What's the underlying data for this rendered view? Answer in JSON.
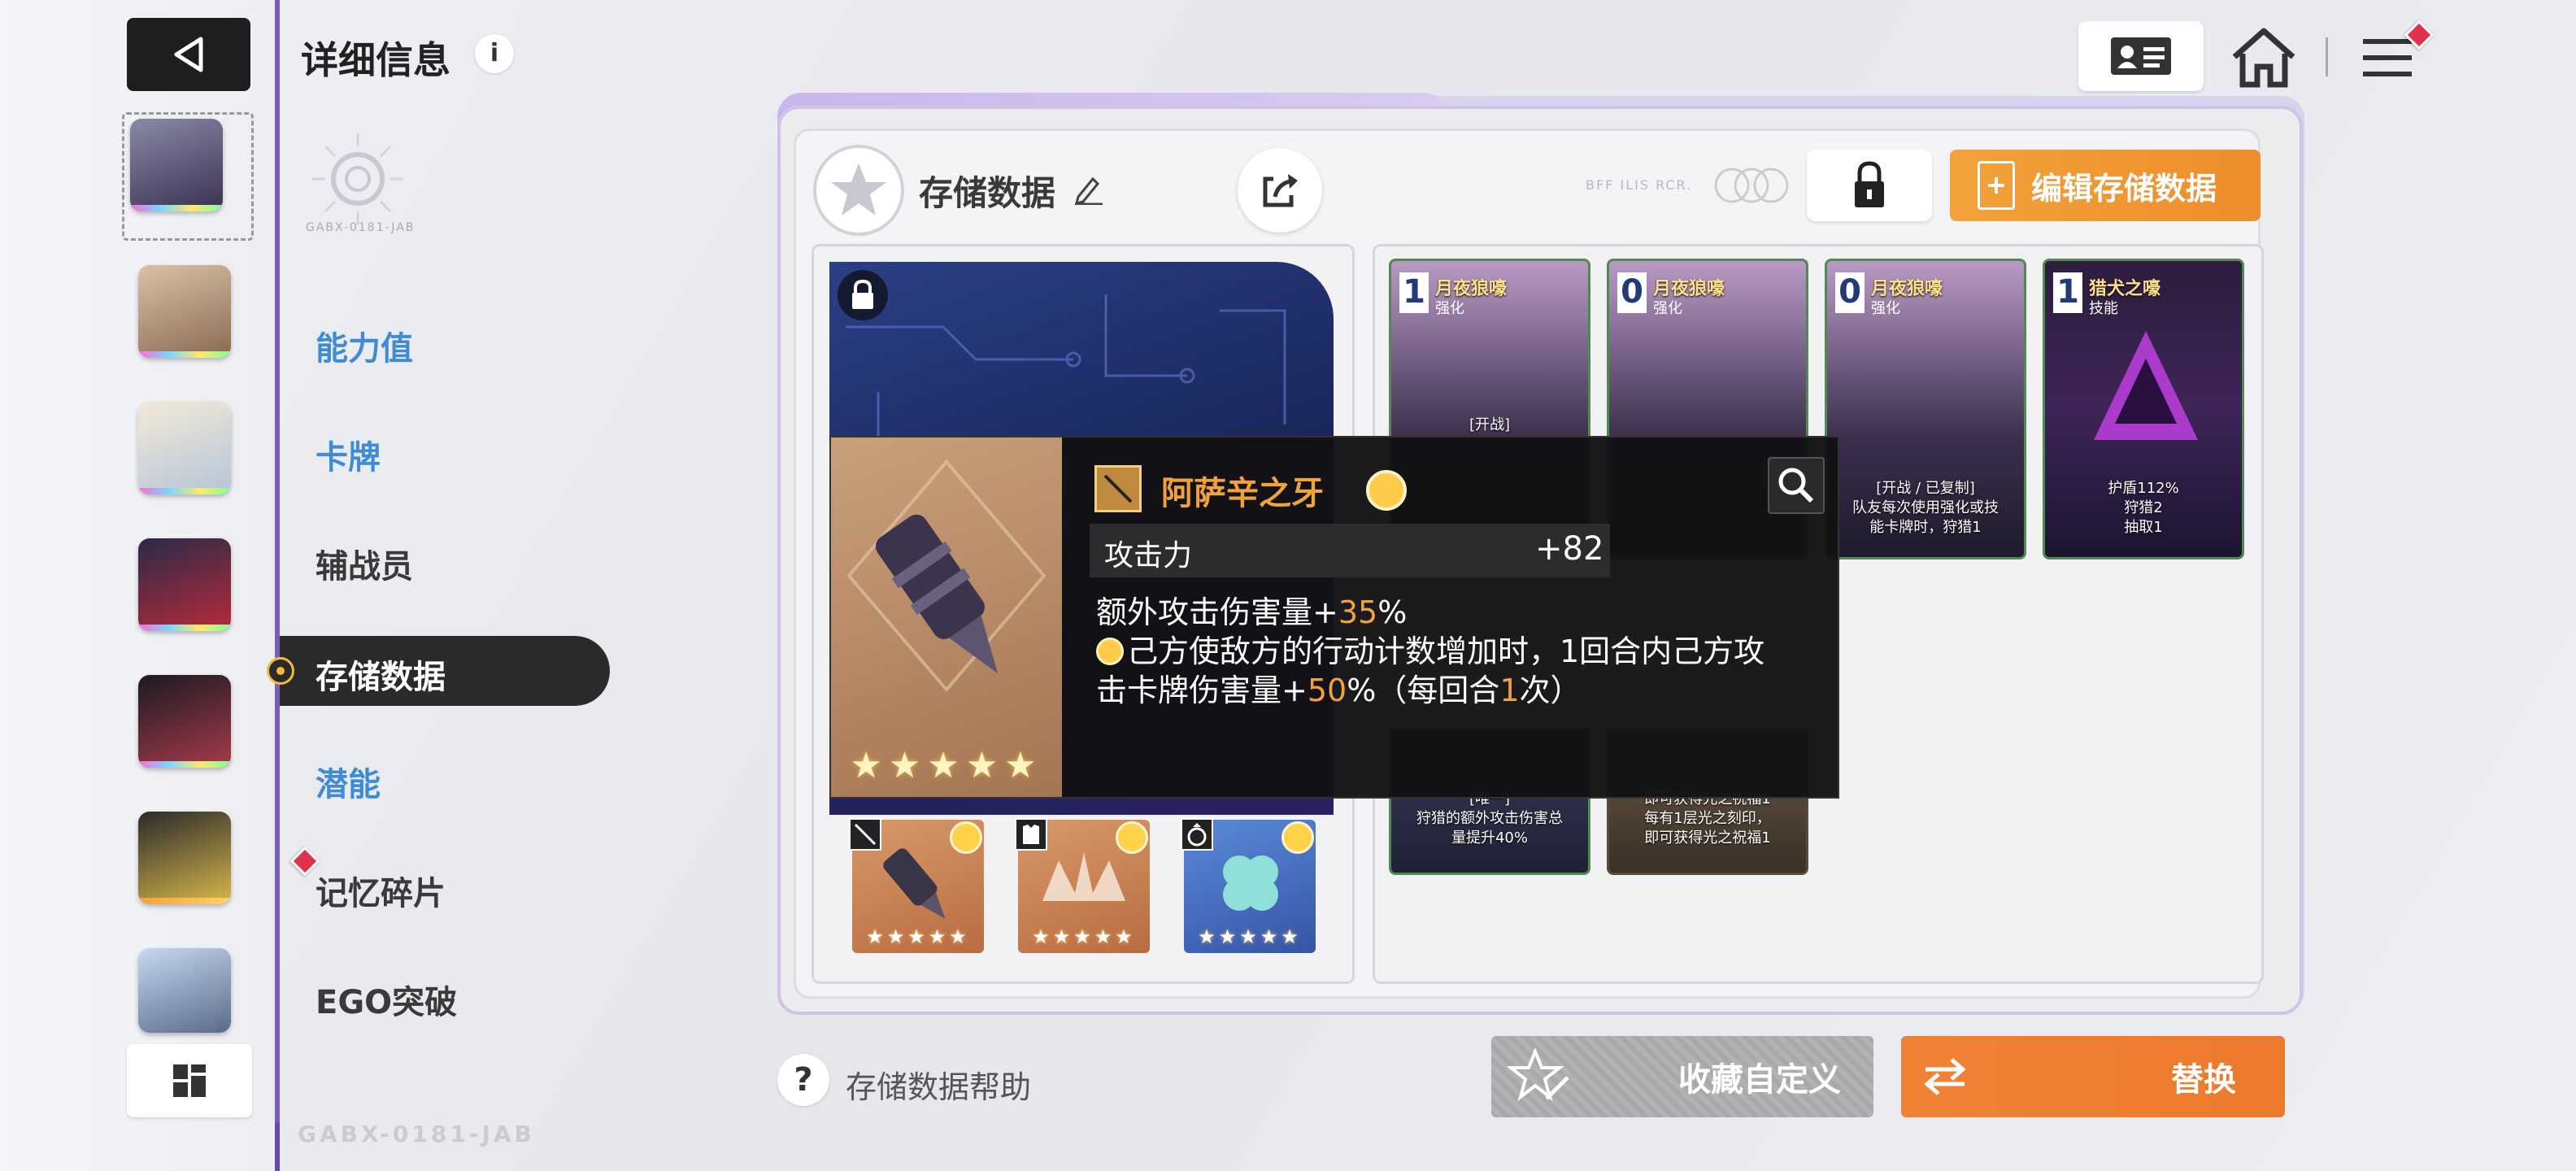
{
  "header": {
    "title": "详细信息",
    "info_label": "i",
    "emblem_text": "GABX-0181-JAB"
  },
  "side_menu": {
    "items": [
      {
        "label": "能力值"
      },
      {
        "label": "卡牌"
      },
      {
        "label": "辅战员"
      },
      {
        "label": "存储数据"
      },
      {
        "label": "潜能"
      },
      {
        "label": "记忆碎片"
      },
      {
        "label": "EGO突破"
      }
    ],
    "active": "存储数据",
    "footer_tag": "GABX-0181-JAB"
  },
  "storage": {
    "title": "存储数据",
    "faint_label": "BFF ILIS RCR.",
    "edit_button": "编辑存储数据"
  },
  "tooltip": {
    "name": "阿萨辛之牙",
    "stat_name": "攻击力",
    "stat_value": "+82",
    "line1_prefix": "额外攻击伤害量+",
    "line1_value": "35",
    "line1_suffix": "%",
    "line2_a": "己方使敌方的行动计数增加时，1回合内己方攻",
    "line3_a": "击卡牌伤害量+",
    "line3_value": "50",
    "line3_b": "%（每回合",
    "line3_count": "1",
    "line3_c": "次）",
    "stars": "★★★★★"
  },
  "equipment": {
    "slots": [
      {
        "stars": "★★★★★"
      },
      {
        "stars": "★★★★★"
      },
      {
        "stars": "★★★★★"
      }
    ]
  },
  "deck": {
    "cards": [
      {
        "cost": "1",
        "name": "月夜狼嚎",
        "type": "强化",
        "desc": "[开战]"
      },
      {
        "cost": "0",
        "name": "月夜狼嚎",
        "type": "强化",
        "desc": ""
      },
      {
        "cost": "0",
        "name": "月夜狼嚎",
        "type": "强化",
        "desc": "[开战 / 已复制]\n队友每次使用强化或技\n能卡牌时，狩猎1"
      },
      {
        "cost": "1",
        "name": "猎犬之嚎",
        "type": "技能",
        "desc": "护盾112%\n狩猎2\n抽取1"
      }
    ],
    "lower_cards": [
      {
        "desc": "[唯一]\n狩猎的额外攻击伤害总\n量提升40%"
      },
      {
        "desc": "即可获得光之祝福1\n每有1层光之刻印，\n即可获得光之祝福1"
      }
    ]
  },
  "bottom": {
    "help_icon": "?",
    "help_label": "存储数据帮助",
    "favorite_button": "收藏自定义",
    "replace_button": "替换"
  },
  "colors": {
    "accent_orange": "#f3a23b",
    "menu_blue": "#3e8bd6",
    "rail_purple": "#7a5fb8",
    "badge_red": "#e0324a"
  }
}
